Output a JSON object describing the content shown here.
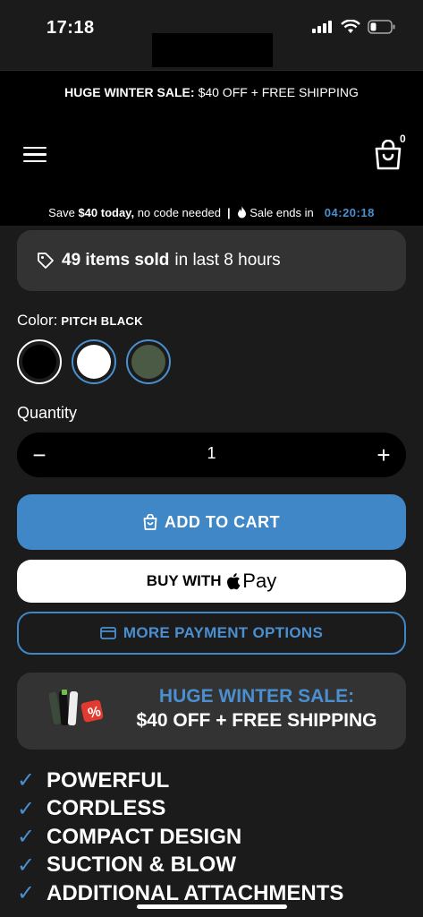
{
  "status_bar": {
    "time": "17:18"
  },
  "promo": {
    "bold": "HUGE WINTER SALE:",
    "text": "$40 OFF + FREE SHIPPING"
  },
  "header": {
    "cart_count": "0",
    "icons": [
      "menu-icon",
      "shopping-bag-icon"
    ]
  },
  "timer": {
    "save_prefix": "Save",
    "save_amount": "$40 today,",
    "save_suffix": "no code needed",
    "separator": "|",
    "ends_label": "Sale ends in",
    "countdown": "04:20:18"
  },
  "sold": {
    "count": "49 items sold",
    "suffix": "in last 8 hours"
  },
  "color": {
    "label": "Color:",
    "selected": "PITCH BLACK",
    "swatches": [
      {
        "name": "black",
        "hex": "#000000"
      },
      {
        "name": "white",
        "hex": "#ffffff"
      },
      {
        "name": "green",
        "hex": "#4a5a45"
      }
    ]
  },
  "quantity": {
    "label": "Quantity",
    "value": "1",
    "minus": "−",
    "plus": "+"
  },
  "buttons": {
    "add_to_cart": "ADD TO CART",
    "buy_with": "BUY WITH",
    "pay_brand": "Pay",
    "more_payment": "MORE PAYMENT OPTIONS"
  },
  "sale_card": {
    "line1": "HUGE WINTER SALE:",
    "line2": "$40 OFF + FREE SHIPPING"
  },
  "features": [
    "POWERFUL",
    "CORDLESS",
    "COMPACT DESIGN",
    "SUCTION & BLOW",
    "ADDITIONAL ATTACHMENTS"
  ],
  "check_mark": "✓",
  "colors": {
    "accent": "#3f87c6",
    "card": "#333333",
    "background": "#1b1b1b"
  }
}
